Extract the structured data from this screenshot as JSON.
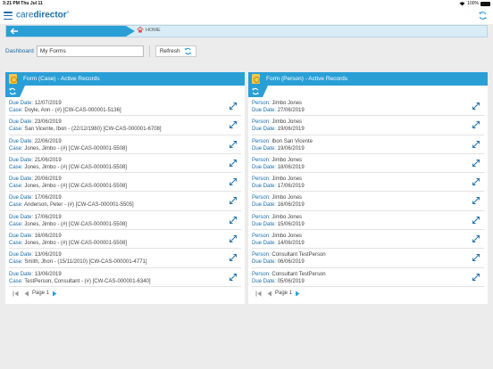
{
  "status": {
    "time": "3:21 PM",
    "date": "Thu Jul 11",
    "battery": "100%"
  },
  "app": {
    "logo_light": "care",
    "logo_bold": "director",
    "logo_mark": "®"
  },
  "nav": {
    "home_label": "HOME"
  },
  "toolbar": {
    "dashboard_label": "Dashboard",
    "dashboard_value": "My Forms",
    "refresh_label": "Refresh"
  },
  "colors": {
    "accent": "#2a9fd6",
    "link": "#1a6ea8",
    "nav_bg": "#d9edf7"
  },
  "panels": [
    {
      "title": "Form (Case) - Active Records",
      "rows": [
        {
          "l1": "Due Date:",
          "v1": "12/07/2019",
          "l2": "Case:",
          "v2": "Doyle, Ann - (#) [CW-CAS-000001-5136]"
        },
        {
          "l1": "Due Date:",
          "v1": "23/06/2019",
          "l2": "Case:",
          "v2": "San Vicente, Ibon - (22/12/1980) [CW-CAS-000001-6708]"
        },
        {
          "l1": "Due Date:",
          "v1": "22/06/2019",
          "l2": "Case:",
          "v2": "Jones, Jimbo - (#) [CW-CAS-000001-5508]"
        },
        {
          "l1": "Due Date:",
          "v1": "21/06/2019",
          "l2": "Case:",
          "v2": "Jones, Jimbo - (#) [CW-CAS-000001-5508]"
        },
        {
          "l1": "Due Date:",
          "v1": "20/06/2019",
          "l2": "Case:",
          "v2": "Jones, Jimbo - (#) [CW-CAS-000001-5508]"
        },
        {
          "l1": "Due Date:",
          "v1": "17/06/2019",
          "l2": "Case:",
          "v2": "Anderson, Peter - (#) [CW-CAS-000001-5505]"
        },
        {
          "l1": "Due Date:",
          "v1": "17/06/2019",
          "l2": "Case:",
          "v2": "Jones, Jimbo - (#) [CW-CAS-000001-5508]"
        },
        {
          "l1": "Due Date:",
          "v1": "16/06/2019",
          "l2": "Case:",
          "v2": "Jones, Jimbo - (#) [CW-CAS-000001-5508]"
        },
        {
          "l1": "Due Date:",
          "v1": "13/06/2019",
          "l2": "Case:",
          "v2": "Smith, Jhon - (15/11/2010) [CW-CAS-000001-4771]"
        },
        {
          "l1": "Due Date:",
          "v1": "13/06/2019",
          "l2": "Case:",
          "v2": "TestPerson, Consultant - (#) [CW-CAS-000001-6340]"
        }
      ],
      "page_label": "Page 1"
    },
    {
      "title": "Form (Person) - Active Records",
      "rows": [
        {
          "l1": "Person:",
          "v1": "Jimbo Jones",
          "l2": "Due Date:",
          "v2": "27/06/2019"
        },
        {
          "l1": "Person:",
          "v1": "Jimbo Jones",
          "l2": "Due Date:",
          "v2": "19/06/2019"
        },
        {
          "l1": "Person:",
          "v1": "Ibon San Vicente",
          "l2": "Due Date:",
          "v2": "19/06/2019"
        },
        {
          "l1": "Person:",
          "v1": "Jimbo Jones",
          "l2": "Due Date:",
          "v2": "18/06/2019"
        },
        {
          "l1": "Person:",
          "v1": "Jimbo Jones",
          "l2": "Due Date:",
          "v2": "17/06/2019"
        },
        {
          "l1": "Person:",
          "v1": "Jimbo Jones",
          "l2": "Due Date:",
          "v2": "16/06/2019"
        },
        {
          "l1": "Person:",
          "v1": "Jimbo Jones",
          "l2": "Due Date:",
          "v2": "15/06/2019"
        },
        {
          "l1": "Person:",
          "v1": "Jimbo Jones",
          "l2": "Due Date:",
          "v2": "14/06/2019"
        },
        {
          "l1": "Person:",
          "v1": "Consultant TestPerson",
          "l2": "Due Date:",
          "v2": "06/06/2019"
        },
        {
          "l1": "Person:",
          "v1": "Consultant TestPerson",
          "l2": "Due Date:",
          "v2": "05/06/2019"
        }
      ],
      "page_label": "Page 1"
    }
  ]
}
